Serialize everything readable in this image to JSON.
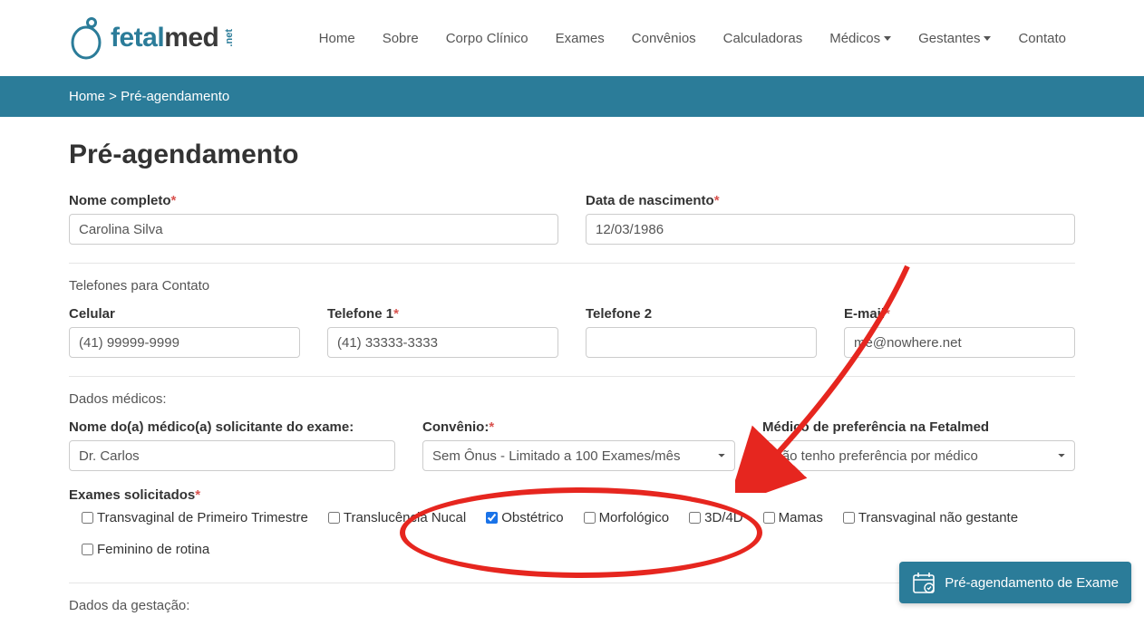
{
  "brand": {
    "name_a": "fetal",
    "name_b": "med",
    "suffix": ".net"
  },
  "nav": {
    "home": "Home",
    "sobre": "Sobre",
    "corpo": "Corpo Clínico",
    "exames": "Exames",
    "convenios": "Convênios",
    "calculadoras": "Calculadoras",
    "medicos": "Médicos",
    "gestantes": "Gestantes",
    "contato": "Contato"
  },
  "breadcrumb": {
    "home": "Home",
    "sep": " > ",
    "current": "Pré-agendamento"
  },
  "title": "Pré-agendamento",
  "labels": {
    "nome": "Nome completo",
    "nasc": "Data de nascimento",
    "tel_section": "Telefones para Contato",
    "celular": "Celular",
    "tel1": "Telefone 1",
    "tel2": "Telefone 2",
    "email": "E-mail",
    "dados_med": "Dados médicos:",
    "medico_sol": "Nome do(a) médico(a) solicitante do exame:",
    "convenio": "Convênio:",
    "medico_pref": "Médico de preferência na Fetalmed",
    "exames_sol": "Exames solicitados",
    "dados_gest": "Dados da gestação:"
  },
  "values": {
    "nome": "Carolina Silva",
    "nasc": "12/03/1986",
    "celular": "(41) 99999-9999",
    "tel1": "(41) 33333-3333",
    "tel2": "",
    "email": "me@nowhere.net",
    "medico_sol": "Dr. Carlos",
    "convenio_selected": "Sem Ônus - Limitado a 100 Exames/mês",
    "medico_pref_selected": "Não tenho preferência por médico"
  },
  "exames": {
    "transvaginal1": "Transvaginal de Primeiro Trimestre",
    "translucencia": "Translucência Nucal",
    "obstetrico": "Obstétrico",
    "morfologico": "Morfológico",
    "3d4d": "3D/4D",
    "mamas": "Mamas",
    "transvaginal_ng": "Transvaginal não gestante",
    "feminino": "Feminino de rotina"
  },
  "exames_checked": {
    "obstetrico": true
  },
  "float_cta": "Pré-agendamento de Exame"
}
